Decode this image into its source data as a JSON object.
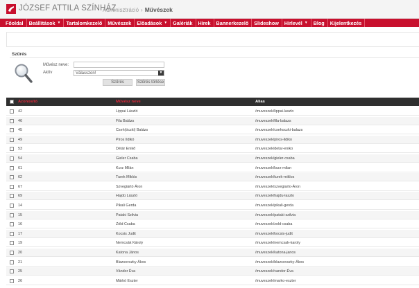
{
  "header": {
    "brand": "JÓZSEF ATTILA SZÍNHÁZ",
    "crumb_parent": "Adminisztráció",
    "crumb_sep": "›",
    "crumb_current": "Művészek"
  },
  "menu": [
    {
      "label": "Főoldal",
      "dropdown": false
    },
    {
      "label": "Beállítások",
      "dropdown": true
    },
    {
      "label": "Tartalomkezelő",
      "dropdown": false
    },
    {
      "label": "Művészek",
      "dropdown": false
    },
    {
      "label": "Előadások",
      "dropdown": true
    },
    {
      "label": "Galériák",
      "dropdown": false
    },
    {
      "label": "Hírek",
      "dropdown": false
    },
    {
      "label": "Bannerkezelő",
      "dropdown": false
    },
    {
      "label": "Slideshow",
      "dropdown": false
    },
    {
      "label": "Hírlevél",
      "dropdown": true
    },
    {
      "label": "Blog",
      "dropdown": false
    },
    {
      "label": "Kijelentkezés",
      "dropdown": false
    }
  ],
  "filter": {
    "title": "Szűrés",
    "name_label": "Művész neve:",
    "name_value": "",
    "active_label": "Aktív",
    "active_value": "Válasszon!",
    "search_button": "Szűrés",
    "clear_button": "Szűrés törlése"
  },
  "table": {
    "columns": {
      "id": "Azonosító",
      "name": "Művész neve",
      "alias": "Alias"
    },
    "rows": [
      {
        "id": "42",
        "name": "Lippai László",
        "alias": "/muveszek/lippai-laszlo"
      },
      {
        "id": "46",
        "name": "Fila Balázs",
        "alias": "/muveszek/fila-balazs"
      },
      {
        "id": "45",
        "name": "Cseh(óczki) Balázs",
        "alias": "/muveszek/csehoczki-balazs"
      },
      {
        "id": "49",
        "name": "Piros Ildikó",
        "alias": "/muveszek/piros-ildiko"
      },
      {
        "id": "53",
        "name": "Détár Enikő",
        "alias": "/muveszek/detar-eniko"
      },
      {
        "id": "54",
        "name": "Gieler Csaba",
        "alias": "/muveszek/gieler-csaba"
      },
      {
        "id": "61",
        "name": "Kurz Milán",
        "alias": "/muveszek/kurz-milan"
      },
      {
        "id": "62",
        "name": "Turek Miklós",
        "alias": "/muveszek/turek-miklos"
      },
      {
        "id": "67",
        "name": "Szvegiártó Áron",
        "alias": "/muveszek/szvegiarto-Áron"
      },
      {
        "id": "69",
        "name": "Hajdú László",
        "alias": "/muveszek/hajdu-laszlo"
      },
      {
        "id": "14",
        "name": "Pikali Gerda",
        "alias": "/muveszek/pikali-gerda"
      },
      {
        "id": "15",
        "name": "Pataki Szilvia",
        "alias": "/muveszek/pataki-szilvia"
      },
      {
        "id": "16",
        "name": "Zöld Csaba",
        "alias": "/muveszek/zold-csaba"
      },
      {
        "id": "17",
        "name": "Kocsis Judit",
        "alias": "/muveszek/kocsis-judit"
      },
      {
        "id": "19",
        "name": "Nemcsák Károly",
        "alias": "/muveszek/nemcsak-karoly"
      },
      {
        "id": "20",
        "name": "Katona János",
        "alias": "/muveszek/katona-janos"
      },
      {
        "id": "21",
        "name": "Blazsovszky Ákos",
        "alias": "/muveszek/blazsovszky-Ákos"
      },
      {
        "id": "25",
        "name": "Vándor Éva",
        "alias": "/muveszek/vandor-Éva"
      },
      {
        "id": "26",
        "name": "Márkó Eszter",
        "alias": "/muveszek/marko-eszter"
      }
    ]
  },
  "colors": {
    "accent": "#c8102e",
    "table_header_bg": "#2f2f2f"
  },
  "icons": {
    "logo": "theatre-logo-icon",
    "filter": "magnifier-icon",
    "dropdown": "caret-down-icon"
  }
}
